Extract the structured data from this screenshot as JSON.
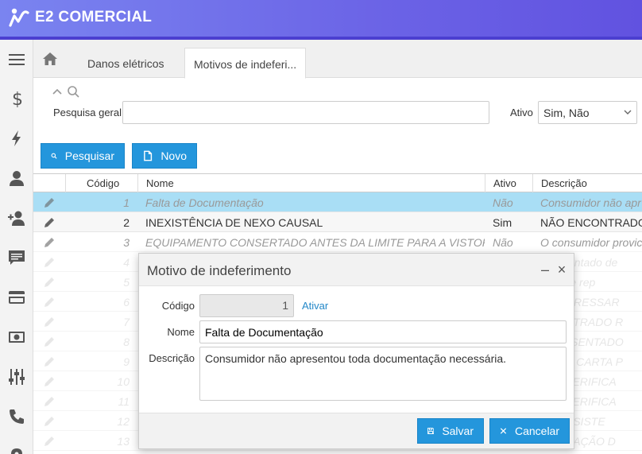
{
  "app": {
    "name": "E2 COMERCIAL"
  },
  "sidebar": {
    "items": [
      {
        "name": "menu-icon"
      },
      {
        "name": "dollar-icon"
      },
      {
        "name": "lightning-icon"
      },
      {
        "name": "user-icon"
      },
      {
        "name": "add-user-icon"
      },
      {
        "name": "chat-icon"
      },
      {
        "name": "credit-card-icon"
      },
      {
        "name": "money-icon"
      },
      {
        "name": "sliders-icon"
      },
      {
        "name": "phone-icon"
      }
    ]
  },
  "tabs": [
    {
      "label": "Danos elétricos"
    },
    {
      "label": "Motivos de indeferi..."
    }
  ],
  "filters": {
    "search_label": "Pesquisa geral",
    "search_value": "",
    "active_label": "Ativo",
    "active_value": "Sim, Não"
  },
  "toolbar": {
    "search_label": "Pesquisar",
    "new_label": "Novo"
  },
  "table": {
    "columns": [
      "Código",
      "Nome",
      "Ativo",
      "Descrição"
    ],
    "rows": [
      {
        "code": "1",
        "name": "Falta de Documentação",
        "active": "Não",
        "desc": "Consumidor não apr"
      },
      {
        "code": "2",
        "name": "INEXISTÊNCIA DE NEXO CAUSAL",
        "active": "Sim",
        "desc": "NÃO ENCONTRADO"
      },
      {
        "code": "3",
        "name": "EQUIPAMENTO CONSERTADO ANTES DA LIMITE PARA A VISTORIA.",
        "active": "Não",
        "desc": "O consumidor provic"
      },
      {
        "code": "4",
        "name": "",
        "active": "",
        "desc": "apresentado de"
      },
      {
        "code": "5",
        "name": "",
        "active": "",
        "desc": "ição de rep"
      },
      {
        "code": "6",
        "name": "",
        "active": "",
        "desc": "IAR O RESSAR"
      },
      {
        "code": "7",
        "name": "",
        "active": "",
        "desc": "NCONTRADO R"
      },
      {
        "code": "8",
        "name": "",
        "active": "",
        "desc": "APRESENTADO"
      },
      {
        "code": "9",
        "name": "",
        "active": "",
        "desc": "RMAR CARTA P"
      },
      {
        "code": "10",
        "name": "",
        "active": "",
        "desc": "STE VERIFICA"
      },
      {
        "code": "11",
        "name": "",
        "active": "",
        "desc": "STE VERIFICA"
      },
      {
        "code": "12",
        "name": "",
        "active": "",
        "desc": "NCONSISTE"
      },
      {
        "code": "13",
        "name": "",
        "active": "",
        "desc": "CORRAÇÃO D"
      }
    ]
  },
  "dialog": {
    "title": "Motivo de indeferimento",
    "code_label": "Código",
    "code_value": "1",
    "activate_link": "Ativar",
    "name_label": "Nome",
    "name_value": "Falta de Documentação",
    "desc_label": "Descrição",
    "desc_value": "Consumidor não apresentou toda documentação necessária.",
    "save_label": "Salvar",
    "cancel_label": "Cancelar",
    "minimize_symbol": "–",
    "close_symbol": "×"
  }
}
